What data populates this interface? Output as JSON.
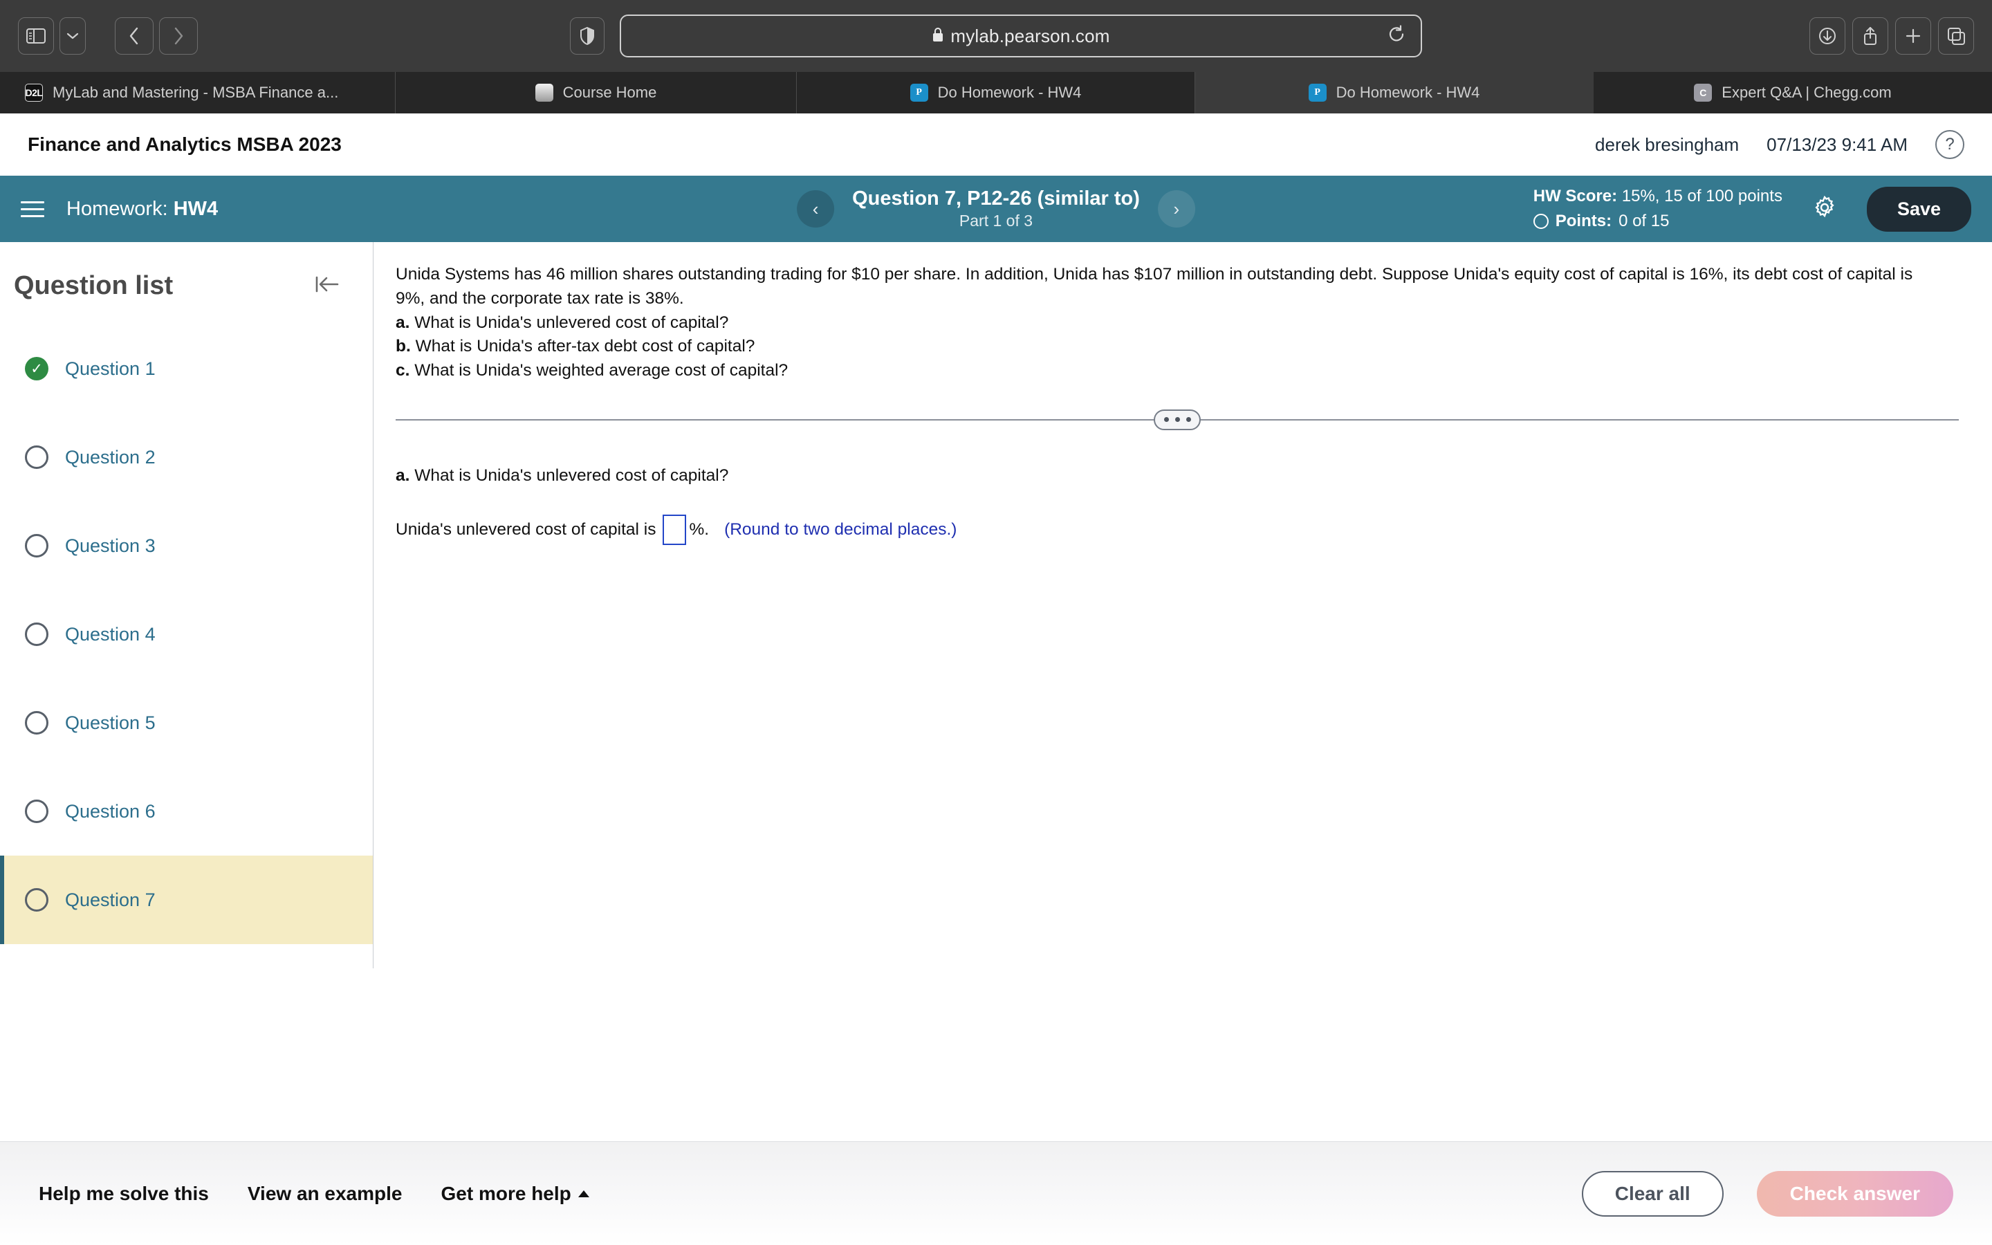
{
  "browser": {
    "url": "mylab.pearson.com",
    "lock_icon": "lock-icon",
    "left_controls": [
      {
        "name": "sidebar-toggle-button",
        "icon": "sidebar-icon"
      },
      {
        "name": "sidebar-dropdown-button",
        "icon": "chevron-down-icon"
      },
      {
        "name": "back-button",
        "icon": "chevron-left-icon"
      },
      {
        "name": "forward-button",
        "icon": "chevron-right-icon"
      }
    ],
    "right_controls": [
      {
        "name": "downloads-button",
        "icon": "download-icon"
      },
      {
        "name": "share-button",
        "icon": "share-icon"
      },
      {
        "name": "new-tab-button",
        "icon": "plus-icon"
      },
      {
        "name": "tab-overview-button",
        "icon": "tabs-icon"
      }
    ],
    "shield_icon": "privacy-shield-icon",
    "reload_icon": "reload-icon",
    "tabs": [
      {
        "title": "MyLab and Mastering - MSBA Finance a...",
        "favicon": "d2l-icon",
        "favicon_text": "D2L",
        "active": false
      },
      {
        "title": "Course Home",
        "favicon": "document-icon",
        "favicon_text": "",
        "active": false
      },
      {
        "title": "Do Homework - HW4",
        "favicon": "pearson-icon",
        "favicon_text": "P",
        "active": false
      },
      {
        "title": "Do Homework - HW4",
        "favicon": "pearson-icon",
        "favicon_text": "P",
        "active": true
      },
      {
        "title": "Expert Q&A | Chegg.com",
        "favicon": "chegg-icon",
        "favicon_text": "C",
        "active": false
      }
    ]
  },
  "app_header": {
    "course_title": "Finance and Analytics MSBA 2023",
    "user_name": "derek bresingham",
    "datetime": "07/13/23 9:41 AM",
    "help_label": "?"
  },
  "toolbar": {
    "menu_icon": "hamburger-menu-icon",
    "homework_prefix": "Homework:",
    "homework_name": "HW4",
    "prev_icon": "‹",
    "next_icon": "›",
    "question_title": "Question 7, P12-26 (similar to)",
    "part_label": "Part 1 of 3",
    "hw_score_label": "HW Score:",
    "hw_score_value": "15%, 15 of 100 points",
    "points_label": "Points:",
    "points_value": "0 of 15",
    "settings_icon": "gear-icon",
    "save_label": "Save"
  },
  "sidebar": {
    "title": "Question list",
    "collapse_icon": "collapse-panel-icon",
    "items": [
      {
        "label": "Question 1",
        "status": "done",
        "selected": false
      },
      {
        "label": "Question 2",
        "status": "open",
        "selected": false
      },
      {
        "label": "Question 3",
        "status": "open",
        "selected": false
      },
      {
        "label": "Question 4",
        "status": "open",
        "selected": false
      },
      {
        "label": "Question 5",
        "status": "open",
        "selected": false
      },
      {
        "label": "Question 6",
        "status": "open",
        "selected": false
      },
      {
        "label": "Question 7",
        "status": "open",
        "selected": true
      }
    ]
  },
  "question": {
    "stem": "Unida Systems has 46 million shares outstanding trading for $10 per share. In addition, Unida has $107 million in outstanding debt. Suppose Unida's equity cost of capital is 16%, its debt cost of capital is 9%, and the corporate tax rate is 38%.",
    "parts": [
      {
        "letter": "a.",
        "text": "What is Unida's unlevered cost of capital?"
      },
      {
        "letter": "b.",
        "text": "What is Unida's after-tax debt cost of capital?"
      },
      {
        "letter": "c.",
        "text": "What is Unida's weighted average cost of capital?"
      }
    ],
    "divider_icon": "drag-handle-icon"
  },
  "answer": {
    "part_letter": "a.",
    "part_text": "What is Unida's unlevered cost of capital?",
    "prefix": "Unida's unlevered cost of capital is",
    "input_value": "",
    "suffix": "%.",
    "hint": "(Round to two decimal places.)"
  },
  "bottom": {
    "help_me_solve": "Help me solve this",
    "view_example": "View an example",
    "get_more_help": "Get more help",
    "get_more_help_icon": "caret-up-icon",
    "clear_all": "Clear all",
    "check_answer": "Check answer"
  },
  "colors": {
    "toolbar_blue": "#35798f",
    "link_blue": "#2c6e8c",
    "selected_row": "#f5ecc4",
    "done_green": "#2e8b43",
    "hint_blue": "#1f2fb0",
    "save_dark": "#1f2c35"
  }
}
